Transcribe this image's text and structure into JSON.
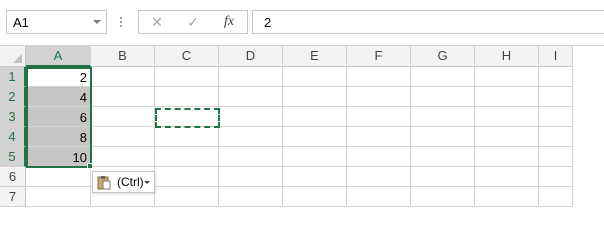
{
  "name_box": {
    "value": "A1"
  },
  "formula_bar": {
    "cancel_glyph": "✕",
    "enter_glyph": "✓",
    "fx_label": "fx",
    "value": "2"
  },
  "columns": [
    "A",
    "B",
    "C",
    "D",
    "E",
    "F",
    "G",
    "H",
    "I"
  ],
  "rows": [
    "1",
    "2",
    "3",
    "4",
    "5",
    "6",
    "7"
  ],
  "column_a_values": [
    "2",
    "4",
    "6",
    "8",
    "10"
  ],
  "paste_options": {
    "label": "(Ctrl)"
  },
  "colors": {
    "accent": "#217346",
    "selection_fill": "#c6c6c6"
  }
}
